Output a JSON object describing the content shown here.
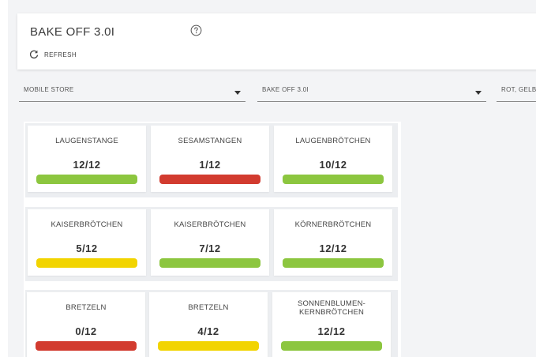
{
  "header": {
    "title": "BAKE OFF 3.0I",
    "help_icon": "help-circle-icon",
    "refresh_icon": "refresh-icon",
    "refresh_label": "REFRESH"
  },
  "filters": [
    {
      "label": "MOBILE STORE"
    },
    {
      "label": "BAKE OFF 3.0I"
    },
    {
      "label": "ROT, GELB"
    }
  ],
  "colors": {
    "green": "#8cc63f",
    "red": "#d23b2f",
    "yellow": "#f2d400"
  },
  "rows": [
    [
      {
        "name": "LAUGENSTANGE",
        "count": "12/12",
        "status": "green"
      },
      {
        "name": "SESAMSTANGEN",
        "count": "1/12",
        "status": "red"
      },
      {
        "name": "LAUGENBRÖTCHEN",
        "count": "10/12",
        "status": "green"
      }
    ],
    [
      {
        "name": "KAISERBRÖTCHEN",
        "count": "5/12",
        "status": "yellow"
      },
      {
        "name": "KAISERBRÖTCHEN",
        "count": "7/12",
        "status": "green"
      },
      {
        "name": "KÖRNERBRÖTCHEN",
        "count": "12/12",
        "status": "green"
      }
    ],
    [
      {
        "name": "BRETZELN",
        "count": "0/12",
        "status": "red"
      },
      {
        "name": "BRETZELN",
        "count": "4/12",
        "status": "yellow"
      },
      {
        "name": "SONNENBLUMEN-\nKERNBRÖTCHEN",
        "count": "12/12",
        "status": "green"
      }
    ]
  ]
}
